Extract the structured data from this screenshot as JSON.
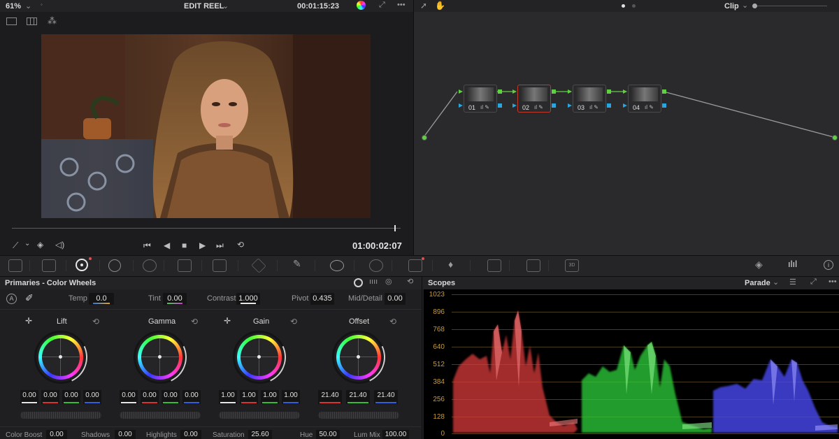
{
  "viewer": {
    "zoom": "61%",
    "title": "EDIT REEL",
    "timecode_top": "00:01:15:23",
    "timecode": "01:00:02:07",
    "progress": 0.985
  },
  "node_editor": {
    "mode": "Clip",
    "nodes": [
      {
        "label": "01",
        "selected": false
      },
      {
        "label": "02",
        "selected": true
      },
      {
        "label": "03",
        "selected": false
      },
      {
        "label": "04",
        "selected": false
      }
    ]
  },
  "primaries": {
    "title": "Primaries - Color Wheels",
    "auto_label": "A",
    "params": {
      "temp_label": "Temp",
      "temp": "0.0",
      "tint_label": "Tint",
      "tint": "0.00",
      "contrast_label": "Contrast",
      "contrast": "1.000",
      "pivot_label": "Pivot",
      "pivot": "0.435",
      "middetail_label": "Mid/Detail",
      "middetail": "0.00"
    },
    "wheels": [
      {
        "name": "Lift",
        "values": [
          "0.00",
          "0.00",
          "0.00",
          "0.00"
        ]
      },
      {
        "name": "Gamma",
        "values": [
          "0.00",
          "0.00",
          "0.00",
          "0.00"
        ]
      },
      {
        "name": "Gain",
        "values": [
          "1.00",
          "1.00",
          "1.00",
          "1.00"
        ]
      },
      {
        "name": "Offset",
        "values": [
          "21.40",
          "21.40",
          "21.40"
        ]
      }
    ],
    "bottom": {
      "color_boost_label": "Color Boost",
      "color_boost": "0.00",
      "shadows_label": "Shadows",
      "shadows": "0.00",
      "highlights_label": "Highlights",
      "highlights": "0.00",
      "saturation_label": "Saturation",
      "saturation": "25.60",
      "hue_label": "Hue",
      "hue": "50.00",
      "lum_mix_label": "Lum Mix",
      "lum_mix": "100.00"
    }
  },
  "scopes": {
    "title": "Scopes",
    "mode": "Parade",
    "scale": [
      "1023",
      "896",
      "768",
      "640",
      "512",
      "384",
      "256",
      "128",
      "0"
    ]
  },
  "colors": {
    "accent_red": "#c0392b",
    "port_green": "#5fd040",
    "port_blue": "#27a6e0",
    "scope_label": "#c89a3a"
  }
}
